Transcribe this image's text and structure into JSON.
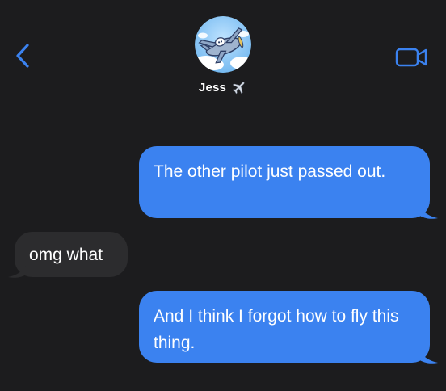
{
  "header": {
    "contact_name": "Jess",
    "name_emoji": "airplane-icon",
    "avatar": "cartoon-airplane-avatar",
    "back_icon": "chevron-left-icon",
    "video_icon": "video-camera-icon"
  },
  "colors": {
    "background": "#1c1c1e",
    "sent_bubble": "#3b82f0",
    "received_bubble": "#2c2c2e",
    "accent": "#3b82f0",
    "text": "#ffffff"
  },
  "messages": [
    {
      "direction": "sent",
      "text": "The other pilot just passed out."
    },
    {
      "direction": "received",
      "text": "omg what"
    },
    {
      "direction": "sent",
      "text": "And I think I forgot how to fly this thing."
    }
  ]
}
